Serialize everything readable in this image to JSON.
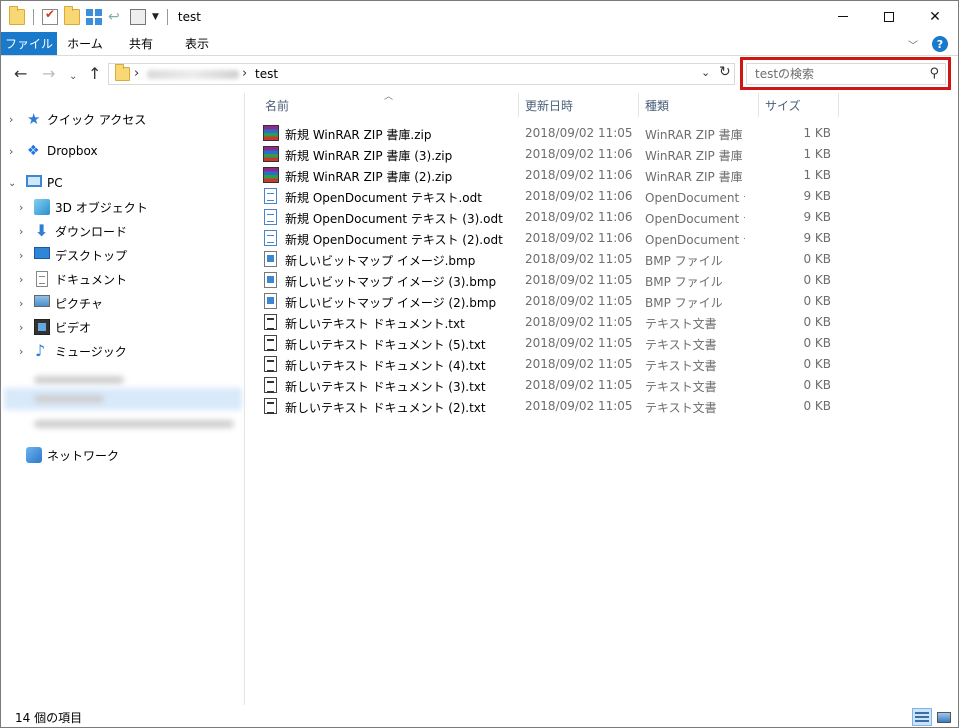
{
  "window": {
    "title": "test",
    "controls": {
      "minimize": "minimize",
      "maximize": "maximize",
      "close": "close"
    }
  },
  "ribbon": {
    "tabs": [
      {
        "label": "ファイル"
      },
      {
        "label": "ホーム"
      },
      {
        "label": "共有"
      },
      {
        "label": "表示"
      }
    ],
    "help_label": "?"
  },
  "address": {
    "current_folder": "test"
  },
  "search": {
    "placeholder": "testの検索"
  },
  "nav_pane": {
    "items": [
      {
        "label": "クイック アクセス",
        "icon": "star-icon"
      },
      {
        "label": "Dropbox",
        "icon": "dropbox-icon"
      },
      {
        "label": "PC",
        "icon": "pc-icon"
      },
      {
        "label": "3D オブジェクト",
        "icon": "3d-objects-icon"
      },
      {
        "label": "ダウンロード",
        "icon": "download-icon"
      },
      {
        "label": "デスクトップ",
        "icon": "desktop-icon"
      },
      {
        "label": "ドキュメント",
        "icon": "documents-icon"
      },
      {
        "label": "ピクチャ",
        "icon": "pictures-icon"
      },
      {
        "label": "ビデオ",
        "icon": "videos-icon"
      },
      {
        "label": "ミュージック",
        "icon": "music-icon"
      },
      {
        "label": "ネットワーク",
        "icon": "network-icon"
      }
    ]
  },
  "file_list": {
    "columns": {
      "name": "名前",
      "date": "更新日時",
      "type": "種類",
      "size": "サイズ"
    },
    "rows": [
      {
        "name": "新規 WinRAR ZIP 書庫.zip",
        "date": "2018/09/02 11:05",
        "type": "WinRAR ZIP 書庫",
        "size": "1 KB",
        "icon": "winrar-icon"
      },
      {
        "name": "新規 WinRAR ZIP 書庫 (3).zip",
        "date": "2018/09/02 11:06",
        "type": "WinRAR ZIP 書庫",
        "size": "1 KB",
        "icon": "winrar-icon"
      },
      {
        "name": "新規 WinRAR ZIP 書庫 (2).zip",
        "date": "2018/09/02 11:06",
        "type": "WinRAR ZIP 書庫",
        "size": "1 KB",
        "icon": "winrar-icon"
      },
      {
        "name": "新規 OpenDocument テキスト.odt",
        "date": "2018/09/02 11:06",
        "type": "OpenDocument テ",
        "size": "9 KB",
        "icon": "odt-icon"
      },
      {
        "name": "新規 OpenDocument テキスト (3).odt",
        "date": "2018/09/02 11:06",
        "type": "OpenDocument テ",
        "size": "9 KB",
        "icon": "odt-icon"
      },
      {
        "name": "新規 OpenDocument テキスト (2).odt",
        "date": "2018/09/02 11:06",
        "type": "OpenDocument テ",
        "size": "9 KB",
        "icon": "odt-icon"
      },
      {
        "name": "新しいビットマップ イメージ.bmp",
        "date": "2018/09/02 11:05",
        "type": "BMP ファイル",
        "size": "0 KB",
        "icon": "bmp-icon"
      },
      {
        "name": "新しいビットマップ イメージ (3).bmp",
        "date": "2018/09/02 11:05",
        "type": "BMP ファイル",
        "size": "0 KB",
        "icon": "bmp-icon"
      },
      {
        "name": "新しいビットマップ イメージ (2).bmp",
        "date": "2018/09/02 11:05",
        "type": "BMP ファイル",
        "size": "0 KB",
        "icon": "bmp-icon"
      },
      {
        "name": "新しいテキスト ドキュメント.txt",
        "date": "2018/09/02 11:05",
        "type": "テキスト文書",
        "size": "0 KB",
        "icon": "txt-icon"
      },
      {
        "name": "新しいテキスト ドキュメント (5).txt",
        "date": "2018/09/02 11:05",
        "type": "テキスト文書",
        "size": "0 KB",
        "icon": "txt-icon"
      },
      {
        "name": "新しいテキスト ドキュメント (4).txt",
        "date": "2018/09/02 11:05",
        "type": "テキスト文書",
        "size": "0 KB",
        "icon": "txt-icon"
      },
      {
        "name": "新しいテキスト ドキュメント (3).txt",
        "date": "2018/09/02 11:05",
        "type": "テキスト文書",
        "size": "0 KB",
        "icon": "txt-icon"
      },
      {
        "name": "新しいテキスト ドキュメント (2).txt",
        "date": "2018/09/02 11:05",
        "type": "テキスト文書",
        "size": "0 KB",
        "icon": "txt-icon"
      }
    ]
  },
  "status_bar": {
    "item_count": "14 個の項目"
  },
  "colors": {
    "accent": "#1979ca",
    "highlight_border": "#d11414",
    "selection": "#d8e9fa"
  }
}
